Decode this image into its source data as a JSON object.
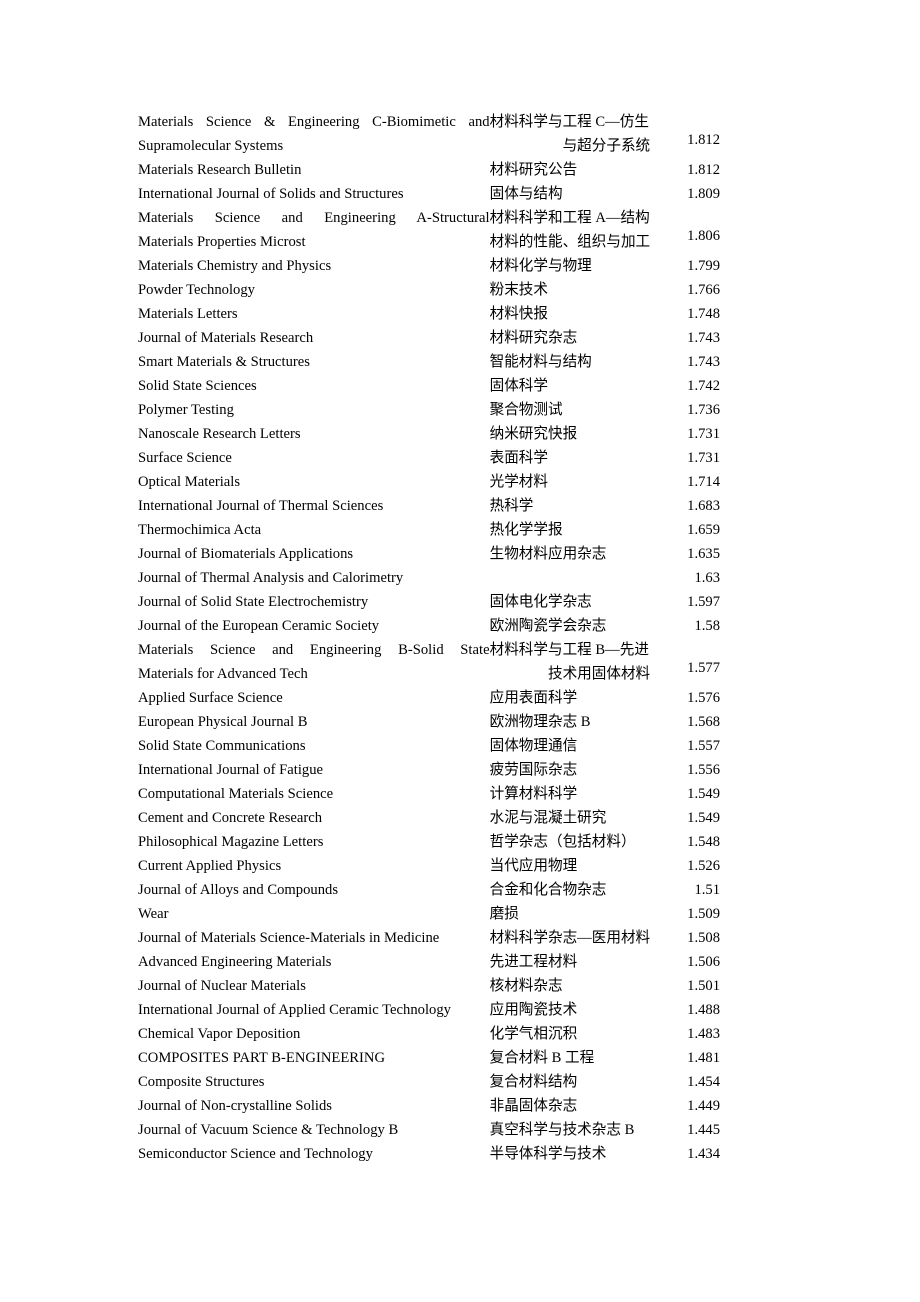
{
  "document": {
    "type": "journal-impact-factor-table",
    "background_color": "#ffffff",
    "text_color": "#000000",
    "columns": {
      "english_header": "",
      "chinese_header": "",
      "impact_factor_header": ""
    }
  },
  "rows": [
    {
      "en_lines": [
        "Materials  Science  &  Engineering  C-Biomimetic  and",
        "Supramolecular Systems"
      ],
      "cn_lines": [
        "材料科学与工程 C—仿生",
        "与超分子系统"
      ],
      "impact_factor": "1.812",
      "multiline": true
    },
    {
      "en_lines": [
        "Materials Research Bulletin"
      ],
      "cn_lines": [
        "材料研究公告"
      ],
      "impact_factor": "1.812",
      "multiline": false
    },
    {
      "en_lines": [
        "International Journal of Solids and Structures"
      ],
      "cn_lines": [
        "固体与结构"
      ],
      "impact_factor": "1.809",
      "multiline": false
    },
    {
      "en_lines": [
        "Materials   Science   and   Engineering   A-Structural",
        "Materials Properties Microst"
      ],
      "cn_lines": [
        "材料科学和工程 A—结构",
        "材料的性能、组织与加工"
      ],
      "impact_factor": "1.806",
      "multiline": true
    },
    {
      "en_lines": [
        "Materials Chemistry and Physics"
      ],
      "cn_lines": [
        "材料化学与物理"
      ],
      "impact_factor": "1.799",
      "multiline": false
    },
    {
      "en_lines": [
        "Powder Technology"
      ],
      "cn_lines": [
        "粉末技术"
      ],
      "impact_factor": "1.766",
      "multiline": false
    },
    {
      "en_lines": [
        "Materials Letters"
      ],
      "cn_lines": [
        "材料快报"
      ],
      "impact_factor": "1.748",
      "multiline": false
    },
    {
      "en_lines": [
        "Journal of Materials Research"
      ],
      "cn_lines": [
        "材料研究杂志"
      ],
      "impact_factor": "1.743",
      "multiline": false
    },
    {
      "en_lines": [
        "Smart Materials & Structures"
      ],
      "cn_lines": [
        "智能材料与结构"
      ],
      "impact_factor": "1.743",
      "multiline": false
    },
    {
      "en_lines": [
        "Solid State Sciences"
      ],
      "cn_lines": [
        "固体科学"
      ],
      "impact_factor": "1.742",
      "multiline": false
    },
    {
      "en_lines": [
        "Polymer Testing"
      ],
      "cn_lines": [
        "聚合物测试"
      ],
      "impact_factor": "1.736",
      "multiline": false
    },
    {
      "en_lines": [
        "Nanoscale Research Letters"
      ],
      "cn_lines": [
        "纳米研究快报"
      ],
      "impact_factor": "1.731",
      "multiline": false
    },
    {
      "en_lines": [
        "Surface Science"
      ],
      "cn_lines": [
        "表面科学"
      ],
      "impact_factor": "1.731",
      "multiline": false
    },
    {
      "en_lines": [
        "Optical Materials"
      ],
      "cn_lines": [
        "光学材料"
      ],
      "impact_factor": "1.714",
      "multiline": false
    },
    {
      "en_lines": [
        "International Journal of Thermal Sciences"
      ],
      "cn_lines": [
        "热科学"
      ],
      "impact_factor": "1.683",
      "multiline": false
    },
    {
      "en_lines": [
        "Thermochimica Acta"
      ],
      "cn_lines": [
        "热化学学报"
      ],
      "impact_factor": "1.659",
      "multiline": false
    },
    {
      "en_lines": [
        "Journal of Biomaterials Applications"
      ],
      "cn_lines": [
        "生物材料应用杂志"
      ],
      "impact_factor": "1.635",
      "multiline": false
    },
    {
      "en_lines": [
        "Journal of Thermal Analysis and Calorimetry"
      ],
      "cn_lines": [
        ""
      ],
      "impact_factor": "1.63",
      "multiline": false
    },
    {
      "en_lines": [
        "Journal of Solid State Electrochemistry"
      ],
      "cn_lines": [
        "固体电化学杂志"
      ],
      "impact_factor": "1.597",
      "multiline": false
    },
    {
      "en_lines": [
        "Journal of the European Ceramic Society"
      ],
      "cn_lines": [
        "欧洲陶瓷学会杂志"
      ],
      "impact_factor": "1.58",
      "multiline": false
    },
    {
      "en_lines": [
        "Materials  Science  and  Engineering  B-Solid  State",
        "Materials for Advanced Tech"
      ],
      "cn_lines": [
        "材料科学与工程 B—先进",
        "技术用固体材料"
      ],
      "impact_factor": "1.577",
      "multiline": true
    },
    {
      "en_lines": [
        "Applied Surface Science"
      ],
      "cn_lines": [
        "应用表面科学"
      ],
      "impact_factor": "1.576",
      "multiline": false
    },
    {
      "en_lines": [
        "European Physical Journal B"
      ],
      "cn_lines": [
        "欧洲物理杂志 B"
      ],
      "impact_factor": "1.568",
      "multiline": false
    },
    {
      "en_lines": [
        "Solid State Communications"
      ],
      "cn_lines": [
        "固体物理通信"
      ],
      "impact_factor": "1.557",
      "multiline": false
    },
    {
      "en_lines": [
        "International Journal of Fatigue"
      ],
      "cn_lines": [
        "疲劳国际杂志"
      ],
      "impact_factor": "1.556",
      "multiline": false
    },
    {
      "en_lines": [
        "Computational Materials Science"
      ],
      "cn_lines": [
        "计算材料科学"
      ],
      "impact_factor": "1.549",
      "multiline": false
    },
    {
      "en_lines": [
        "Cement and Concrete Research"
      ],
      "cn_lines": [
        "水泥与混凝土研究"
      ],
      "impact_factor": "1.549",
      "multiline": false
    },
    {
      "en_lines": [
        "Philosophical Magazine Letters"
      ],
      "cn_lines": [
        "哲学杂志（包括材料）"
      ],
      "impact_factor": "1.548",
      "multiline": false
    },
    {
      "en_lines": [
        "Current Applied Physics"
      ],
      "cn_lines": [
        "当代应用物理"
      ],
      "impact_factor": "1.526",
      "multiline": false
    },
    {
      "en_lines": [
        "Journal of Alloys and Compounds"
      ],
      "cn_lines": [
        "合金和化合物杂志"
      ],
      "impact_factor": "1.51",
      "multiline": false
    },
    {
      "en_lines": [
        "Wear"
      ],
      "cn_lines": [
        "磨损"
      ],
      "impact_factor": "1.509",
      "multiline": false
    },
    {
      "en_lines": [
        "Journal of Materials Science-Materials in Medicine"
      ],
      "cn_lines": [
        "材料科学杂志—医用材料"
      ],
      "impact_factor": "1.508",
      "multiline": false,
      "cn_wide": true
    },
    {
      "en_lines": [
        "Advanced Engineering Materials"
      ],
      "cn_lines": [
        "先进工程材料"
      ],
      "impact_factor": "1.506",
      "multiline": false
    },
    {
      "en_lines": [
        "Journal of Nuclear Materials"
      ],
      "cn_lines": [
        "核材料杂志"
      ],
      "impact_factor": "1.501",
      "multiline": false
    },
    {
      "en_lines": [
        "International Journal of Applied Ceramic Technology"
      ],
      "cn_lines": [
        "应用陶瓷技术"
      ],
      "impact_factor": "1.488",
      "multiline": false
    },
    {
      "en_lines": [
        "Chemical Vapor Deposition"
      ],
      "cn_lines": [
        "化学气相沉积"
      ],
      "impact_factor": "1.483",
      "multiline": false
    },
    {
      "en_lines": [
        "COMPOSITES PART B-ENGINEERING"
      ],
      "cn_lines": [
        "复合材料 B 工程"
      ],
      "impact_factor": "1.481",
      "multiline": false
    },
    {
      "en_lines": [
        "Composite Structures"
      ],
      "cn_lines": [
        "复合材料结构"
      ],
      "impact_factor": "1.454",
      "multiline": false
    },
    {
      "en_lines": [
        "Journal of Non-crystalline Solids"
      ],
      "cn_lines": [
        "非晶固体杂志"
      ],
      "impact_factor": "1.449",
      "multiline": false
    },
    {
      "en_lines": [
        "Journal of Vacuum Science & Technology B"
      ],
      "cn_lines": [
        "真空科学与技术杂志 B"
      ],
      "impact_factor": "1.445",
      "multiline": false
    },
    {
      "en_lines": [
        "Semiconductor Science and Technology"
      ],
      "cn_lines": [
        "半导体科学与技术"
      ],
      "impact_factor": "1.434",
      "multiline": false
    }
  ]
}
